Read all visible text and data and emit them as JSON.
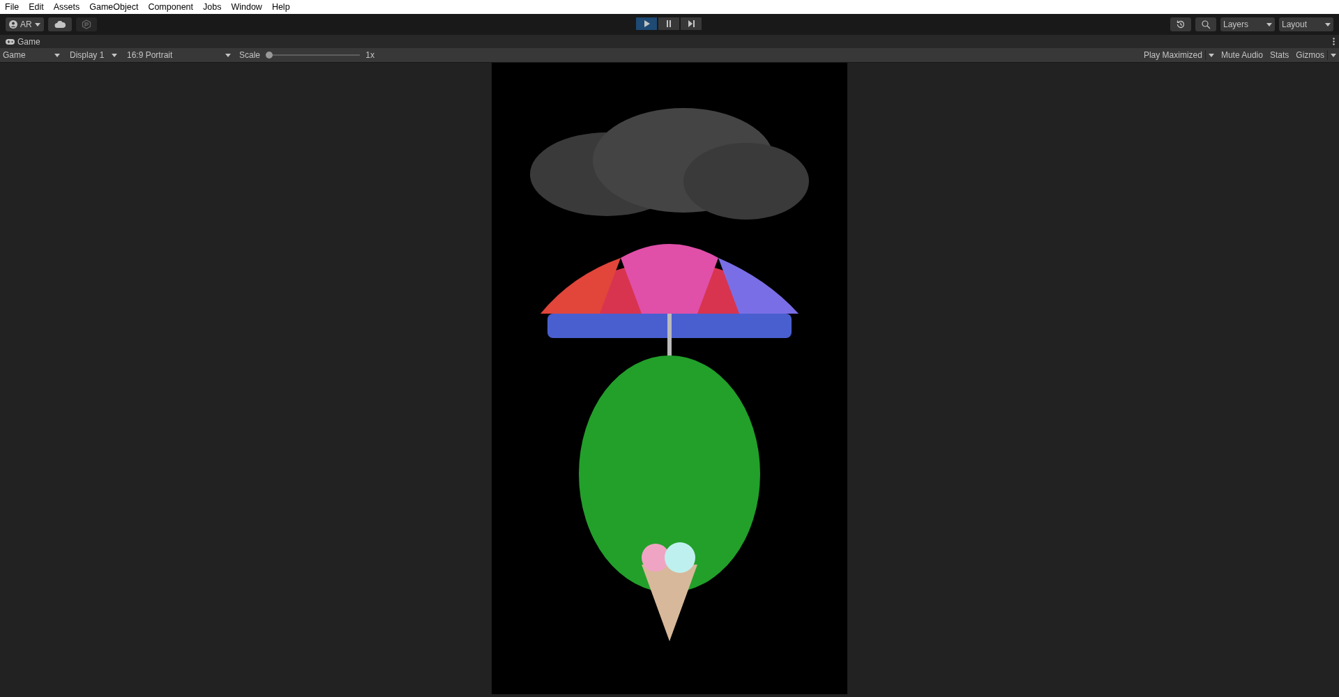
{
  "menu_bar": {
    "items": [
      "File",
      "Edit",
      "Assets",
      "GameObject",
      "Component",
      "Jobs",
      "Window",
      "Help"
    ]
  },
  "toolbar": {
    "account": {
      "label": "AR"
    },
    "playback": [
      {
        "kind": "play",
        "selected": true
      },
      {
        "kind": "pause",
        "selected": false
      },
      {
        "kind": "step",
        "selected": false
      }
    ],
    "layers": {
      "label": "Layers"
    },
    "layout": {
      "label": "Layout"
    }
  },
  "game_tab": {
    "title": "Game"
  },
  "game_controls": {
    "view": "Game",
    "display": "Display 1",
    "aspect": "16:9 Portrait",
    "scale": {
      "label": "Scale",
      "level": 0,
      "reading": "1x"
    },
    "toggles": [
      {
        "label": "Play Maximized",
        "dropdown": true,
        "selected": false
      },
      {
        "label": "Mute Audio",
        "dropdown": false,
        "selected": false
      },
      {
        "label": "Stats",
        "dropdown": false,
        "selected": false
      },
      {
        "label": "Gizmos",
        "dropdown": true,
        "selected": false
      }
    ]
  }
}
